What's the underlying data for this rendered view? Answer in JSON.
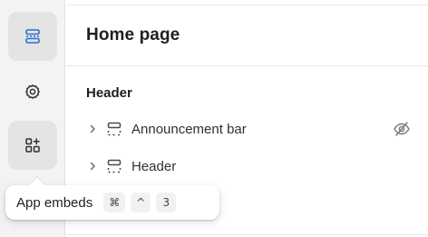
{
  "panel": {
    "title": "Home page",
    "group_title": "Header",
    "items": [
      {
        "label": "Announcement bar",
        "icon": "section-icon",
        "hidden": true,
        "hidden_icon": "eye-off-icon"
      },
      {
        "label": "Header",
        "icon": "section-icon",
        "hidden": false
      }
    ]
  },
  "rail": {
    "items": [
      {
        "name": "sections",
        "icon": "sections-icon",
        "active": true
      },
      {
        "name": "settings",
        "icon": "gear-icon",
        "active": false
      },
      {
        "name": "app-embeds",
        "icon": "app-embeds-icon",
        "active": false,
        "hovered": true
      }
    ]
  },
  "tooltip": {
    "label": "App embeds",
    "shortcut": [
      "⌘",
      "^",
      "3"
    ]
  },
  "colors": {
    "accent": "#2c6ecb",
    "rail_bg": "#f3f3f3",
    "rail_active_bg": "#e4e4e4",
    "text": "#303030"
  }
}
